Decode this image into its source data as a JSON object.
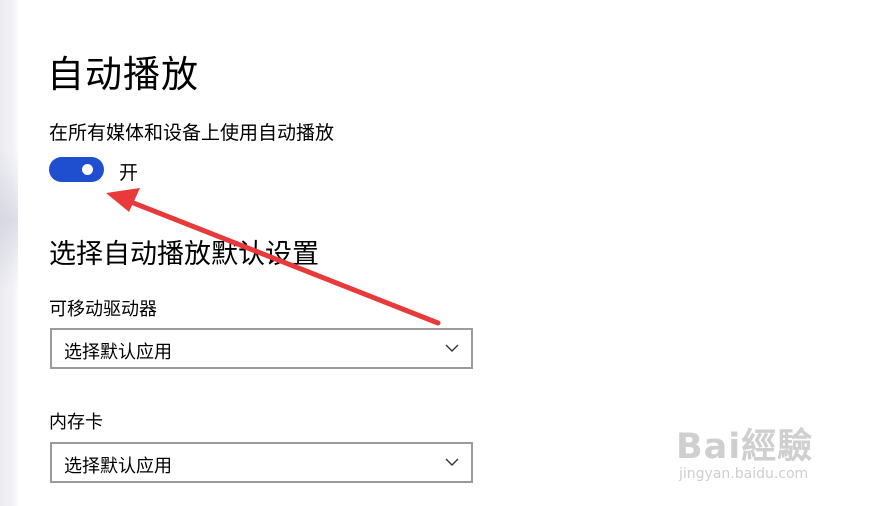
{
  "page": {
    "title": "自动播放"
  },
  "autoplay_setting": {
    "label": "在所有媒体和设备上使用自动播放",
    "toggle_state": "开",
    "toggle_on": true,
    "accent_color": "#1f4fcf"
  },
  "defaults_section": {
    "title": "选择自动播放默认设置",
    "fields": [
      {
        "label": "可移动驱动器",
        "value": "选择默认应用"
      },
      {
        "label": "内存卡",
        "value": "选择默认应用"
      }
    ]
  },
  "annotation": {
    "arrow_color": "#e83a3a"
  },
  "watermark": {
    "brand": "Bai經驗",
    "site": "jingyan.baidu.com"
  }
}
